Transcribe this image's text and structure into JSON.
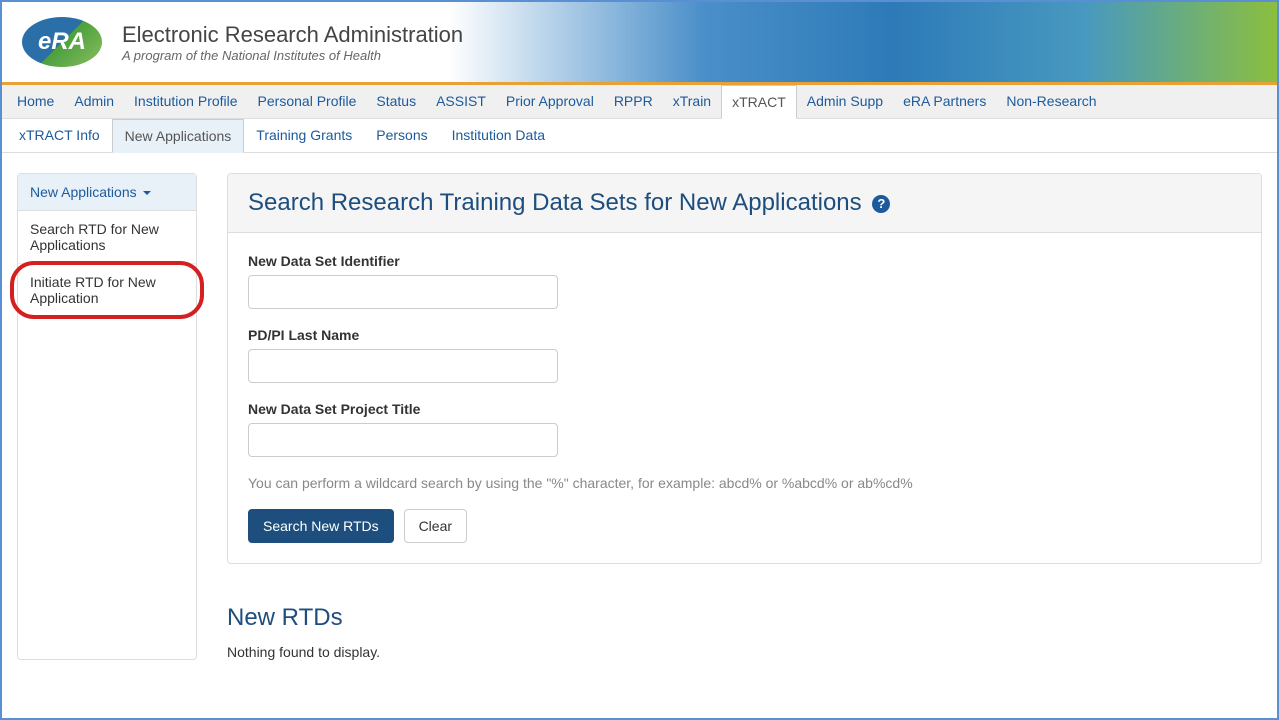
{
  "header": {
    "logo_text": "eRA",
    "title": "Electronic Research Administration",
    "subtitle": "A program of the National Institutes of Health"
  },
  "nav_primary": [
    {
      "label": "Home",
      "active": false
    },
    {
      "label": "Admin",
      "active": false
    },
    {
      "label": "Institution Profile",
      "active": false
    },
    {
      "label": "Personal Profile",
      "active": false
    },
    {
      "label": "Status",
      "active": false
    },
    {
      "label": "ASSIST",
      "active": false
    },
    {
      "label": "Prior Approval",
      "active": false
    },
    {
      "label": "RPPR",
      "active": false
    },
    {
      "label": "xTrain",
      "active": false
    },
    {
      "label": "xTRACT",
      "active": true
    },
    {
      "label": "Admin Supp",
      "active": false
    },
    {
      "label": "eRA Partners",
      "active": false
    },
    {
      "label": "Non-Research",
      "active": false
    }
  ],
  "nav_secondary": [
    {
      "label": "xTRACT Info",
      "active": false
    },
    {
      "label": "New Applications",
      "active": true
    },
    {
      "label": "Training Grants",
      "active": false
    },
    {
      "label": "Persons",
      "active": false
    },
    {
      "label": "Institution Data",
      "active": false
    }
  ],
  "sidebar": {
    "header": "New Applications",
    "items": [
      {
        "label": "Search RTD for New Applications"
      },
      {
        "label": "Initiate RTD for New Application"
      }
    ]
  },
  "panel": {
    "title": "Search Research Training Data Sets for New Applications",
    "fields": {
      "identifier_label": "New Data Set Identifier",
      "identifier_value": "",
      "lastname_label": "PD/PI Last Name",
      "lastname_value": "",
      "title_label": "New Data Set Project Title",
      "title_value": ""
    },
    "hint": "You can perform a wildcard search by using the \"%\" character, for example: abcd% or %abcd% or ab%cd%",
    "search_button": "Search New RTDs",
    "clear_button": "Clear"
  },
  "results": {
    "title": "New RTDs",
    "empty": "Nothing found to display."
  }
}
